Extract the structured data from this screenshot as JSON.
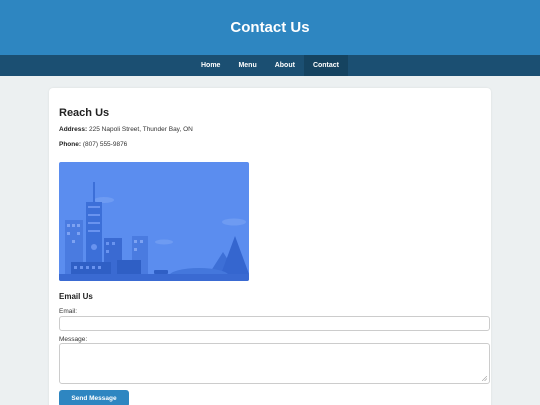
{
  "header": {
    "title": "Contact Us"
  },
  "nav": {
    "items": [
      {
        "label": "Home"
      },
      {
        "label": "Menu"
      },
      {
        "label": "About"
      },
      {
        "label": "Contact"
      }
    ],
    "active": "Contact"
  },
  "reach": {
    "title": "Reach Us",
    "address_label": "Address:",
    "address": "225 Napoli Street, Thunder Bay, ON",
    "phone_label": "Phone:",
    "phone": "(807) 555-9876"
  },
  "image": {
    "icon": "city-skyline-illustration"
  },
  "form": {
    "title": "Email Us",
    "email_label": "Email:",
    "email_value": "",
    "message_label": "Message:",
    "message_value": "",
    "submit_label": "Send Message"
  },
  "colors": {
    "header": "#2e86c1",
    "nav": "#1b4f72",
    "nav_active": "#154360",
    "background": "#ecf0f1",
    "button": "#2e86c1",
    "image_sky": "#5b8def"
  }
}
